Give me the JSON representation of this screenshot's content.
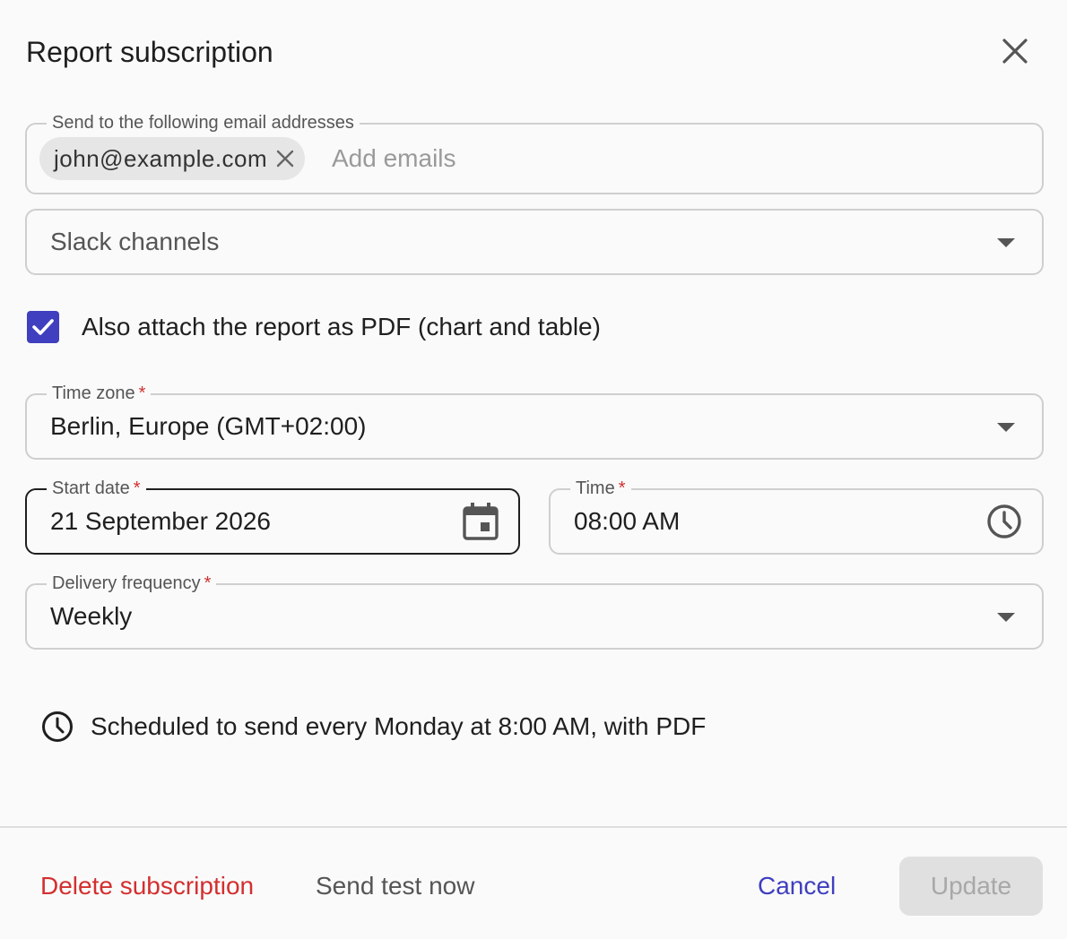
{
  "dialog": {
    "title": "Report subscription"
  },
  "email_field": {
    "label": "Send to the following email addresses",
    "chips": [
      "john@example.com"
    ],
    "placeholder": "Add emails"
  },
  "slack_field": {
    "placeholder": "Slack channels"
  },
  "attach_pdf": {
    "checked": true,
    "label": "Also attach the report as PDF (chart and table)"
  },
  "time_zone": {
    "label": "Time zone",
    "required_mark": "*",
    "value": "Berlin, Europe (GMT+02:00)"
  },
  "start_date": {
    "label": "Start date",
    "required_mark": "*",
    "value": "21 September 2026"
  },
  "time": {
    "label": "Time",
    "required_mark": "*",
    "value": "08:00 AM"
  },
  "delivery_frequency": {
    "label": "Delivery frequency",
    "required_mark": "*",
    "value": "Weekly"
  },
  "summary": {
    "text": "Scheduled to send every Monday at 8:00 AM, with PDF"
  },
  "footer": {
    "delete_label": "Delete subscription",
    "send_test_label": "Send test now",
    "cancel_label": "Cancel",
    "update_label": "Update"
  },
  "colors": {
    "accent": "#3f3fbf",
    "danger": "#d32f2f",
    "disabled_bg": "#e0e0e0",
    "disabled_text": "#a8a8a8"
  },
  "icons": {
    "close": "close-icon",
    "chip_remove": "close-icon",
    "dropdown": "chevron-down-icon",
    "calendar": "calendar-icon",
    "clock": "clock-icon",
    "check": "check-icon"
  }
}
